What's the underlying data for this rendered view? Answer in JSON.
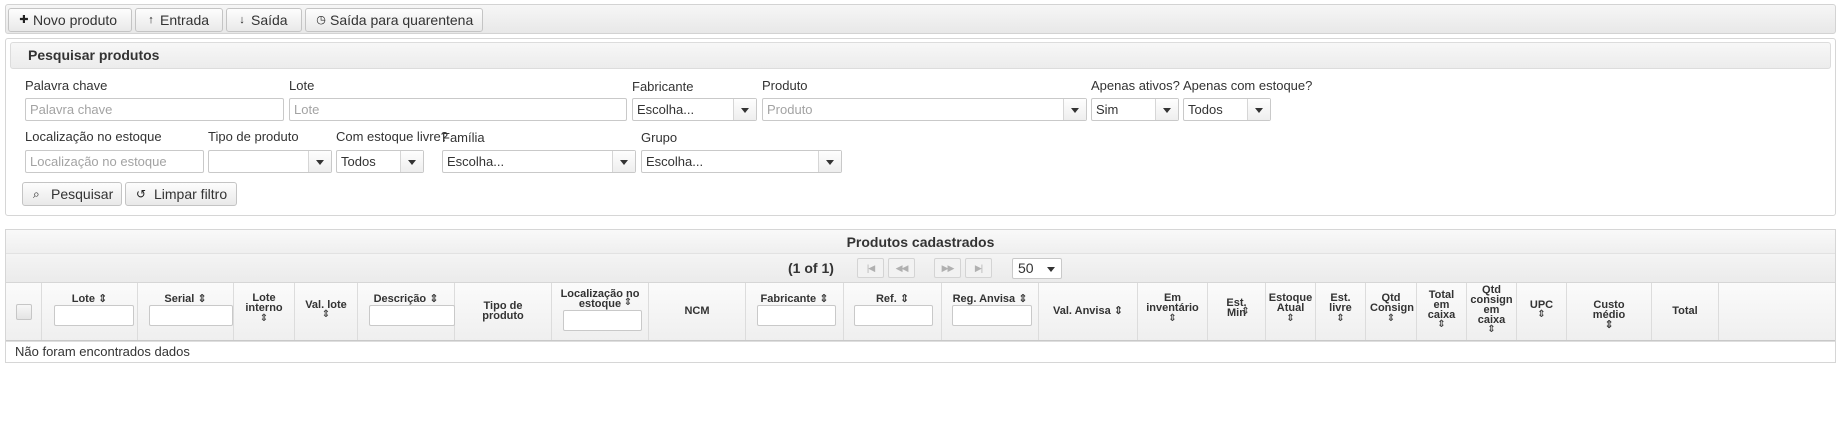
{
  "toolbar": {
    "new_product": "Novo produto",
    "entry": "Entrada",
    "exit": "Saída",
    "quarantine_exit": "Saída para quarentena",
    "icons": {
      "new_product": "plus-icon",
      "entry": "arrow-up-icon",
      "exit": "arrow-down-icon",
      "quarantine_exit": "clock-icon"
    }
  },
  "search": {
    "title": "Pesquisar produtos",
    "keyword": {
      "label": "Palavra chave",
      "placeholder": "Palavra chave",
      "value": ""
    },
    "lot": {
      "label": "Lote",
      "placeholder": "Lote",
      "value": ""
    },
    "manufacturer": {
      "label": "Fabricante",
      "value": "Escolha..."
    },
    "product": {
      "label": "Produto",
      "placeholder": "Produto"
    },
    "only_active": {
      "label": "Apenas ativos?",
      "value": "Sim"
    },
    "only_stock": {
      "label": "Apenas com estoque?",
      "value": "Todos"
    },
    "location": {
      "label": "Localização no estoque",
      "placeholder": "Localização no estoque",
      "value": ""
    },
    "product_type": {
      "label": "Tipo de produto",
      "value": ""
    },
    "free_stock": {
      "label": "Com estoque livre?",
      "value": "Todos"
    },
    "family": {
      "label": "Família",
      "value": "Escolha..."
    },
    "group": {
      "label": "Grupo",
      "value": "Escolha..."
    },
    "search_button": "Pesquisar",
    "clear_button": "Limpar filtro"
  },
  "grid": {
    "title": "Produtos cadastrados",
    "page_info": "(1 of 1)",
    "rows_per_page": "50",
    "columns": {
      "lote": "Lote",
      "serial": "Serial",
      "lote_interno": "Lote interno",
      "val_lote": "Val. lote",
      "descricao": "Descrição",
      "tipo_produto": "Tipo de produto",
      "localizacao": "Localização no estoque",
      "ncm": "NCM",
      "fabricante": "Fabricante",
      "ref": "Ref.",
      "reg_anvisa": "Reg. Anvisa",
      "val_anvisa": "Val. Anvisa",
      "em_inventario": "Em inventário",
      "est_min": "Est. Min",
      "estoque_atual": "Estoque Atual",
      "est_livre": "Est. livre",
      "qtd_consign": "Qtd Consign",
      "total_em_caixa": "Total em caixa",
      "qtd_consign_em_caixa": "Qtd consign em caixa",
      "upc": "UPC",
      "custo_medio": "Custo médio",
      "total": "Total"
    },
    "empty_message": "Não foram encontrados dados"
  }
}
